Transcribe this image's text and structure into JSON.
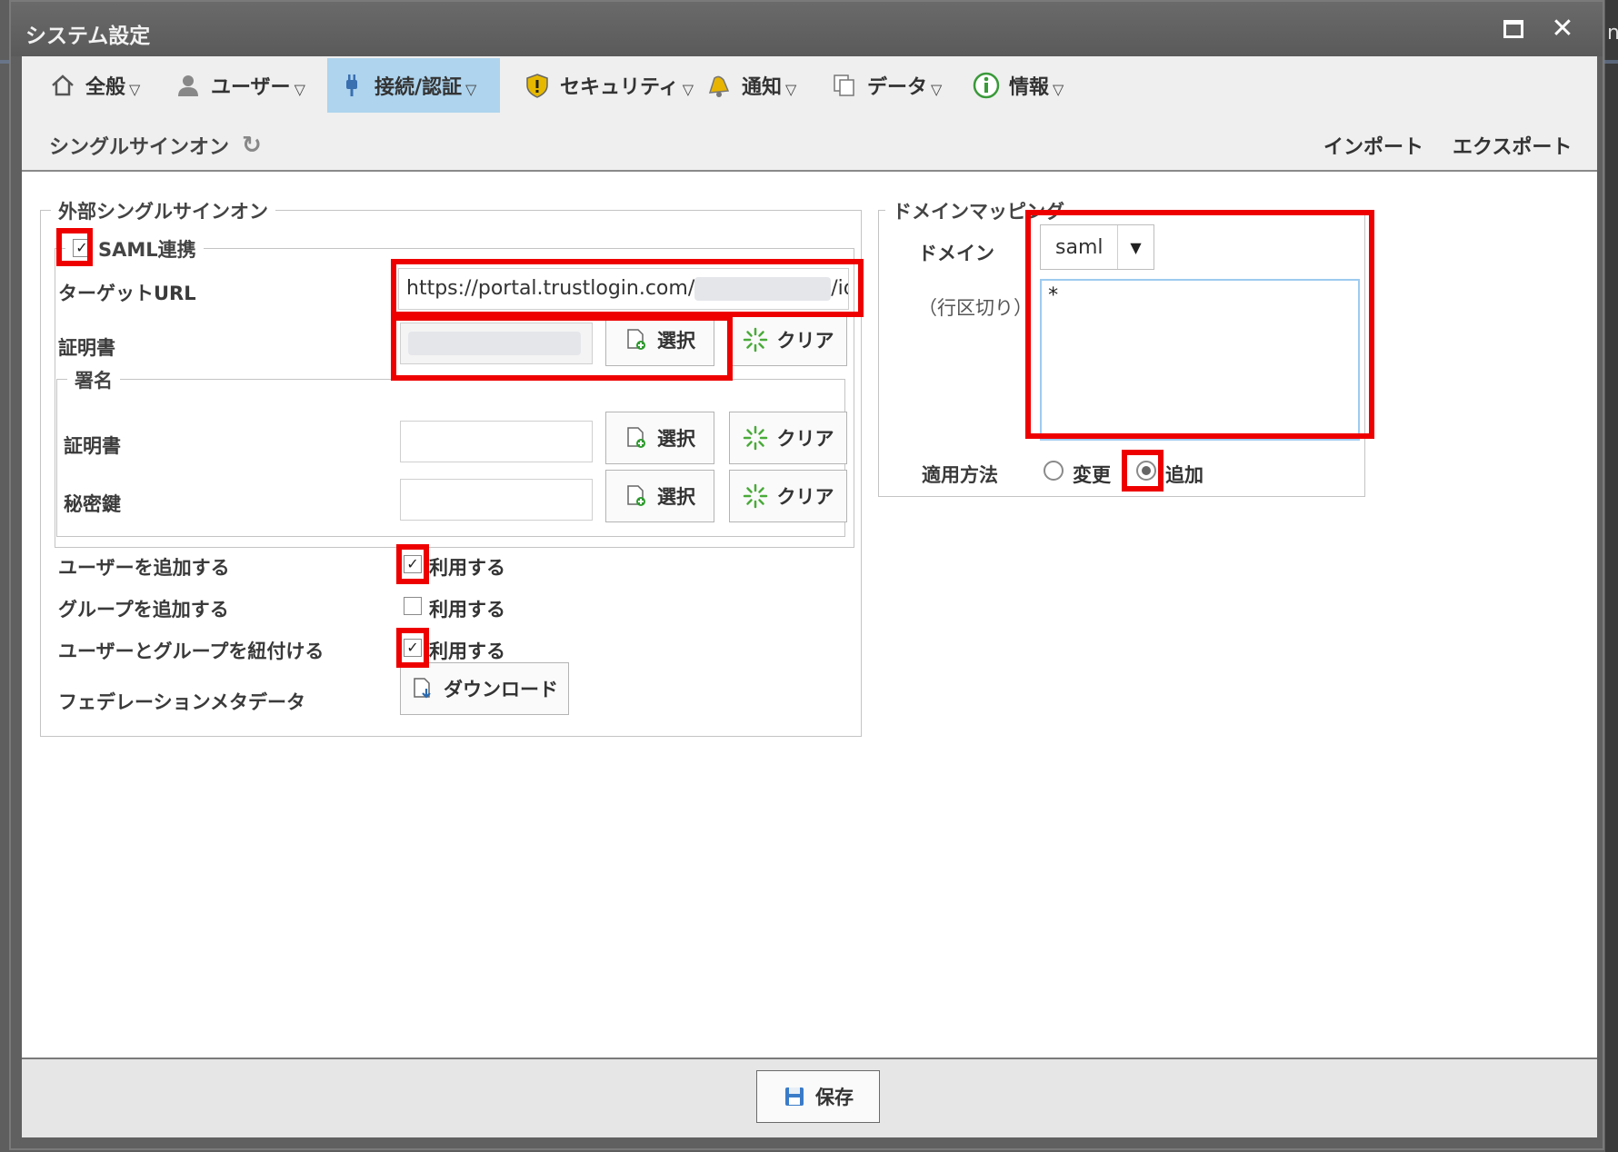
{
  "window": {
    "title": "システム設定"
  },
  "menu": {
    "items": [
      {
        "label": "全般",
        "icon": "home-icon"
      },
      {
        "label": "ユーザー",
        "icon": "user-icon"
      },
      {
        "label": "接続/認証",
        "icon": "plug-icon",
        "active": true
      },
      {
        "label": "セキュリティ",
        "icon": "shield-icon"
      },
      {
        "label": "通知",
        "icon": "bell-icon"
      },
      {
        "label": "データ",
        "icon": "copy-icon"
      },
      {
        "label": "情報",
        "icon": "info-icon"
      }
    ],
    "arrow": "▽"
  },
  "subbar": {
    "section": "シングルサインオン",
    "import": "インポート",
    "export": "エクスポート"
  },
  "sso": {
    "legend": "外部シングルサインオン",
    "saml_legend": "SAML連携",
    "target_url_label": "ターゲットURL",
    "target_url_prefix": "https://portal.trustlogin.com/",
    "target_url_suffix": "/idp/",
    "cert_label": "証明書",
    "select_label": "選択",
    "clear_label": "クリア",
    "signature": {
      "legend": "署名",
      "cert_label": "証明書",
      "private_key_label": "秘密鍵"
    },
    "add_user_label": "ユーザーを追加する",
    "add_group_label": "グループを追加する",
    "link_user_group_label": "ユーザーとグループを紐付ける",
    "use_label": "利用する",
    "federation_label": "フェデレーションメタデータ",
    "download_label": "ダウンロード"
  },
  "domain": {
    "legend": "ドメインマッピング",
    "domain_label": "ドメイン",
    "domain_value": "saml",
    "line_sep_label": "（行区切り）",
    "mapping_value": "*",
    "apply_label": "適用方法",
    "option_change": "変更",
    "option_add": "追加"
  },
  "footer": {
    "save_label": "保存"
  },
  "colors": {
    "active_tab": "#aed4ee",
    "highlight": "#ee0000"
  }
}
